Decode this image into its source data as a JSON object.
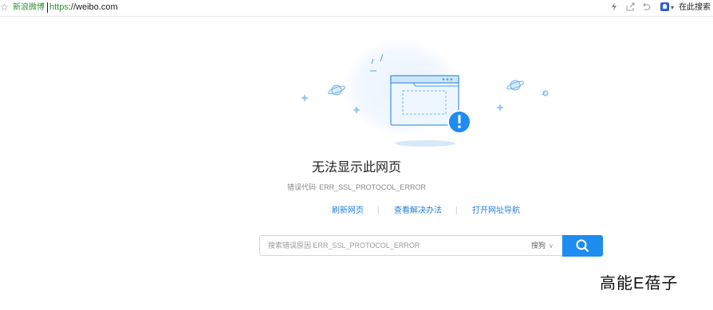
{
  "address_bar": {
    "star_icon": "star-icon",
    "site_name": "新浪微博",
    "url_scheme": "https",
    "url_rest": "://weibo.com",
    "icons": [
      "lightning-icon",
      "share-icon",
      "undo-icon"
    ],
    "engine_icon": "paw-icon",
    "search_here_label": "在此搜索"
  },
  "error": {
    "title": "无法显示此网页",
    "code_label": "错误代码",
    "code": "ERR_SSL_PROTOCOL_ERROR"
  },
  "links": {
    "refresh": "刷新网页",
    "solution": "查看解决办法",
    "nav": "打开网址导航",
    "separator": "|"
  },
  "search": {
    "placeholder": "搜索错误原因 ERR_SSL_PROTOCOL_ERROR",
    "engine": "搜狗",
    "chevron": "∨",
    "button_icon": "search-icon"
  },
  "watermark": "高能E蓓子",
  "colors": {
    "accent": "#1e8cf0",
    "link": "#1e7fd8",
    "site_name_green": "#2f8f2f",
    "illustration_blue": "#4a9be8"
  }
}
